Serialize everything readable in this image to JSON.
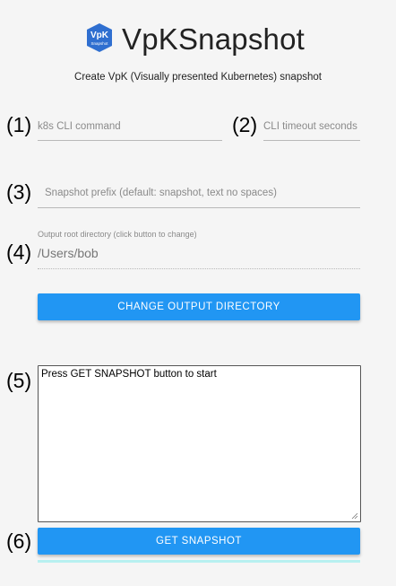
{
  "header": {
    "logo_text_main": "VpK",
    "logo_text_sub": "Snapshot",
    "title": "VpKSnapshot",
    "subtitle": "Create VpK (Visually presented Kubernetes) snapshot"
  },
  "markers": {
    "m1": "(1)",
    "m2": "(2)",
    "m3": "(3)",
    "m4": "(4)",
    "m5": "(5)",
    "m6": "(6)"
  },
  "form": {
    "k8s_cli_placeholder": "k8s CLI command",
    "cli_timeout_placeholder": "CLI timeout seconds",
    "snapshot_prefix_placeholder": "Snapshot prefix (default: snapshot, text no spaces)",
    "output_dir_label": "Output root directory (click button to change)",
    "output_dir_value": "/Users/bob",
    "change_dir_button": "CHANGE OUTPUT DIRECTORY",
    "status_text": "Press GET SNAPSHOT button to start",
    "get_snapshot_button": "GET SNAPSHOT"
  },
  "colors": {
    "primary": "#2196f3",
    "logo": "#2f6fd0",
    "progress": "#b8f0f0"
  }
}
